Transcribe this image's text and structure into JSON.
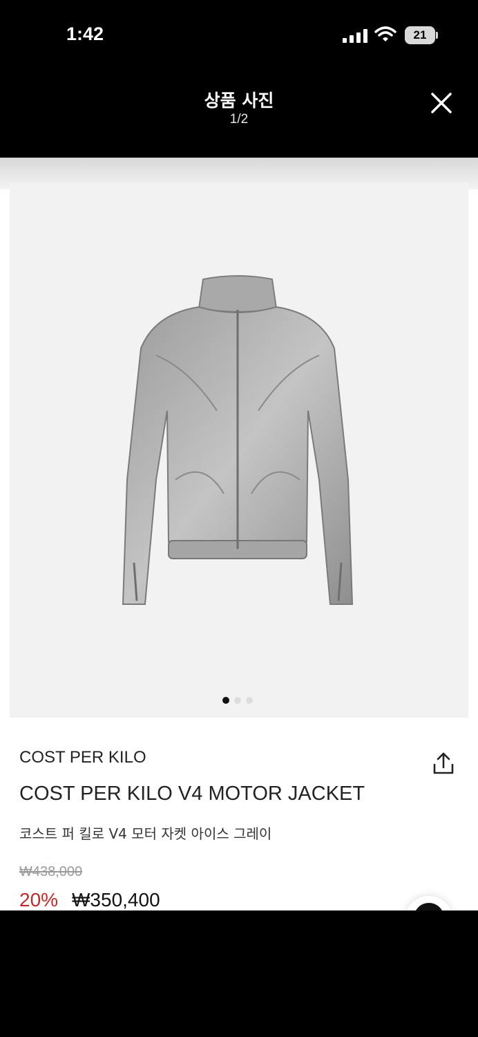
{
  "status_bar": {
    "time": "1:42",
    "battery_level": "21",
    "icons": [
      "cellular-signal-icon",
      "wifi-icon",
      "battery-icon"
    ]
  },
  "header": {
    "title": "상품 사진",
    "counter": "1/2",
    "close_icon": "close-icon"
  },
  "gallery": {
    "image_subject": "gray washed leather motor jacket",
    "page_dots": 3,
    "active_dot": 1
  },
  "product": {
    "brand": "COST PER KILO",
    "name": "COST PER KILO V4 MOTOR JACKET",
    "name_ko": "코스트 퍼 킬로 V4 모터 자켓 아이스 그레이",
    "original_price": "₩438,000",
    "discount": "20%",
    "sale_price": "₩350,400",
    "share_icon": "share-icon"
  },
  "colors": {
    "discount": "#c62828",
    "header_bg": "#000000",
    "image_bg": "#f2f2f2"
  }
}
